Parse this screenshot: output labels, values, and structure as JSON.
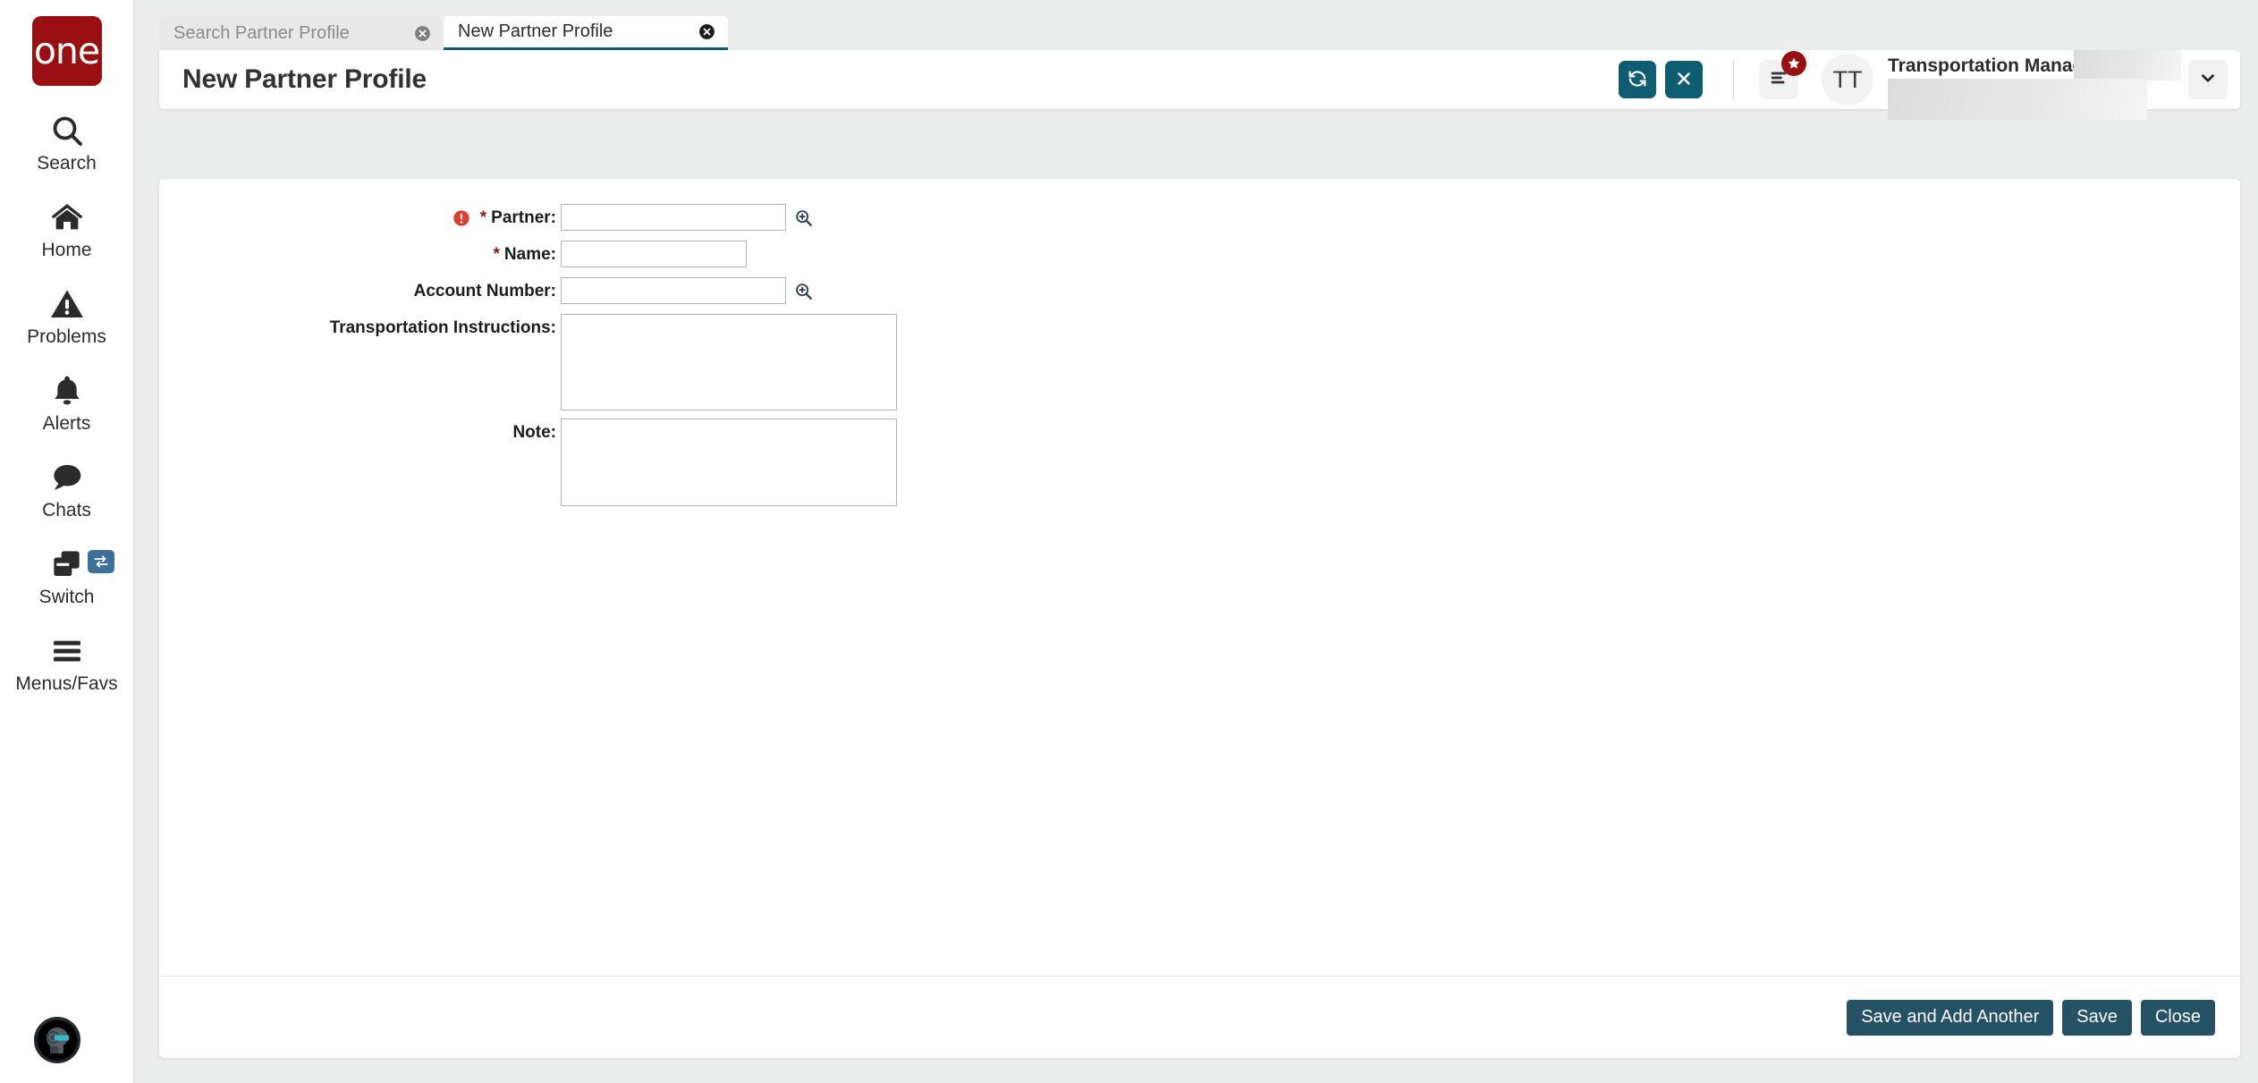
{
  "brand": {
    "logo_text": "one"
  },
  "sidebar": {
    "items": [
      {
        "label": "Search",
        "icon": "search-icon"
      },
      {
        "label": "Home",
        "icon": "home-icon"
      },
      {
        "label": "Problems",
        "icon": "warning-triangle-icon"
      },
      {
        "label": "Alerts",
        "icon": "bell-icon"
      },
      {
        "label": "Chats",
        "icon": "chat-bubble-icon"
      },
      {
        "label": "Switch",
        "icon": "switch-windows-icon"
      },
      {
        "label": "Menus/Favs",
        "icon": "hamburger-icon"
      }
    ],
    "assistant": {
      "icon": "robot-assistant-avatar"
    }
  },
  "tabs": [
    {
      "label": "Search Partner Profile",
      "active": false,
      "close_icon": "close-circle-icon"
    },
    {
      "label": "New Partner Profile",
      "active": true,
      "close_icon": "close-circle-icon"
    }
  ],
  "header": {
    "title": "New Partner Profile",
    "refresh_icon": "refresh-icon",
    "close_icon": "x-icon",
    "menu_icon": "menu-lines-icon",
    "badge_icon": "star-icon",
    "avatar_initials": "TT",
    "user_role": "Transportation Manager",
    "chevron_icon": "chevron-down-icon"
  },
  "form": {
    "fields": [
      {
        "label": "Partner",
        "required": true,
        "has_error": true,
        "has_lookup": true,
        "type": "text",
        "value": "",
        "placeholder": ""
      },
      {
        "label": "Name",
        "required": true,
        "has_error": false,
        "has_lookup": false,
        "type": "text",
        "value": "",
        "placeholder": ""
      },
      {
        "label": "Account Number",
        "required": false,
        "has_error": false,
        "has_lookup": true,
        "type": "text",
        "value": "",
        "placeholder": ""
      },
      {
        "label": "Transportation Instructions",
        "required": false,
        "has_error": false,
        "has_lookup": false,
        "type": "textarea",
        "value": "",
        "placeholder": ""
      },
      {
        "label": "Note",
        "required": false,
        "has_error": false,
        "has_lookup": false,
        "type": "textarea",
        "value": "",
        "placeholder": ""
      }
    ],
    "label_suffix": ":",
    "lookup_icon": "magnifier-zoom-in-icon",
    "error_icon": "error-exclamation-icon"
  },
  "footer": {
    "save_and_add_another_label": "Save and Add Another",
    "save_label": "Save",
    "close_label": "Close"
  },
  "colors": {
    "brand_red": "#9a0f12",
    "teal_action": "#0d5c70",
    "footer_button": "#245163",
    "error_red": "#e03e2d",
    "required_star": "#8b1a1a",
    "switch_badge_blue": "#3d7099",
    "page_background": "#eceded"
  }
}
